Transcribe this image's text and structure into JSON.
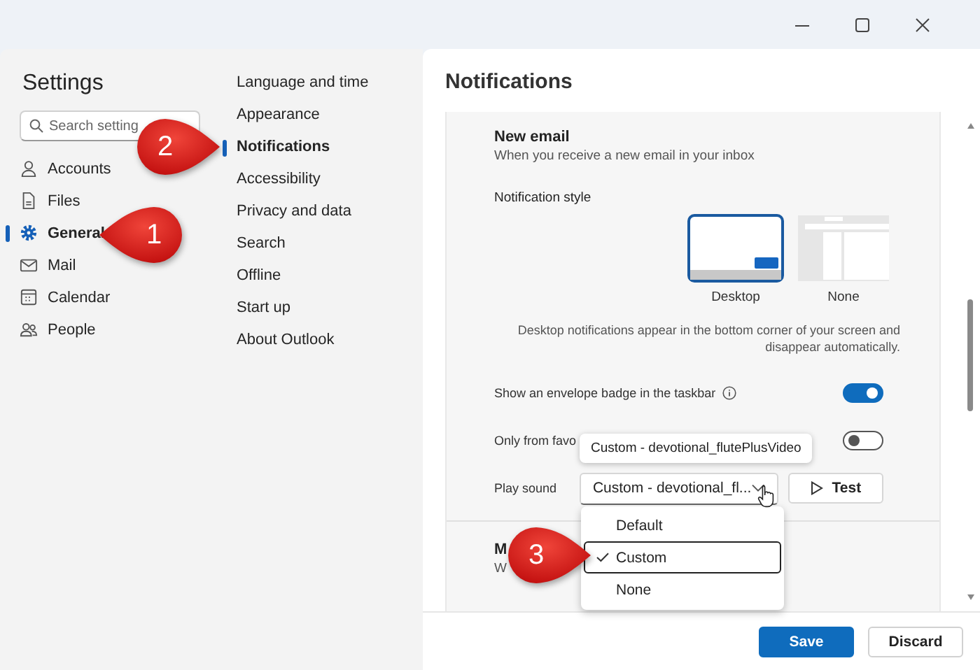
{
  "sidebar": {
    "title": "Settings",
    "search": {
      "placeholder": "Search setting"
    },
    "items": [
      {
        "label": "Accounts",
        "selected": false
      },
      {
        "label": "Files",
        "selected": false
      },
      {
        "label": "General",
        "selected": true
      },
      {
        "label": "Mail",
        "selected": false
      },
      {
        "label": "Calendar",
        "selected": false
      },
      {
        "label": "People",
        "selected": false
      }
    ]
  },
  "subnav": {
    "items": [
      {
        "label": "Language and time",
        "selected": false
      },
      {
        "label": "Appearance",
        "selected": false
      },
      {
        "label": "Notifications",
        "selected": true
      },
      {
        "label": "Accessibility",
        "selected": false
      },
      {
        "label": "Privacy and data",
        "selected": false
      },
      {
        "label": "Search",
        "selected": false
      },
      {
        "label": "Offline",
        "selected": false
      },
      {
        "label": "Start up",
        "selected": false
      },
      {
        "label": "About Outlook",
        "selected": false
      }
    ]
  },
  "panel": {
    "title": "Notifications",
    "section": {
      "title": "New email",
      "subtitle": "When you receive a new email in your inbox",
      "style_label": "Notification style",
      "styles": [
        {
          "label": "Desktop",
          "selected": true
        },
        {
          "label": "None",
          "selected": false
        }
      ],
      "description": "Desktop notifications appear in the bottom corner of your screen and disappear automatically.",
      "rows": [
        {
          "kind": "toggle",
          "label": "Show an envelope badge in the taskbar",
          "info": true,
          "on": true
        },
        {
          "kind": "toggle",
          "label": "Only from favo",
          "on": false
        },
        {
          "kind": "sound",
          "label": "Play sound",
          "value": "Custom - devotional_fl...",
          "test_label": "Test"
        }
      ]
    },
    "section_2": {
      "title": "M",
      "subtitle": "W"
    }
  },
  "tooltip": {
    "text": "Custom - devotional_flutePlusVideo"
  },
  "dropdown": {
    "options": [
      {
        "label": "Default",
        "selected": false
      },
      {
        "label": "Custom",
        "selected": true
      },
      {
        "label": "None",
        "selected": false
      }
    ]
  },
  "footer": {
    "buttons": [
      {
        "label": "Save",
        "kind": "primary"
      },
      {
        "label": "Discard",
        "kind": "secondary"
      }
    ]
  },
  "callouts": [
    {
      "number": "1"
    },
    {
      "number": "2"
    },
    {
      "number": "3"
    }
  ]
}
